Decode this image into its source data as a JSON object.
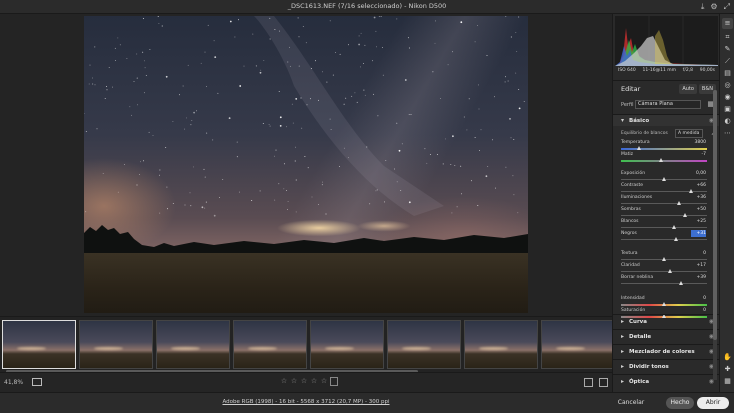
{
  "window": {
    "title": "_DSC1613.NEF (7/16 seleccionado)  -  Nikon D500"
  },
  "titlebar_icons": [
    "save-icon",
    "gear-icon",
    "expand-icon"
  ],
  "panel": {
    "exif": {
      "iso": "ISO 640",
      "lens": "11-16@11 mm",
      "aperture": "f/2,8",
      "shutter": "90,00s"
    },
    "edit": {
      "title": "Editar",
      "auto_label": "Auto",
      "bw_label": "B&N"
    },
    "profile": {
      "label": "Perfil",
      "value": "Cámara Plana"
    },
    "basic": {
      "title": "Básico",
      "wb_label": "Equilibrio de blancos",
      "wb_value": "A medida",
      "sliders": [
        {
          "label": "Temperatura",
          "value": "3800",
          "pos": 0.22,
          "track": "temp"
        },
        {
          "label": "Matiz",
          "value": "-7",
          "pos": 0.47,
          "track": "tint"
        },
        {
          "label": "Exposición",
          "value": "0,00",
          "pos": 0.5,
          "track": ""
        },
        {
          "label": "Contraste",
          "value": "+66",
          "pos": 0.82,
          "track": ""
        },
        {
          "label": "Iluminaciones",
          "value": "+36",
          "pos": 0.68,
          "track": ""
        },
        {
          "label": "Sombras",
          "value": "+50",
          "pos": 0.75,
          "track": ""
        },
        {
          "label": "Blancos",
          "value": "+25",
          "pos": 0.62,
          "track": ""
        },
        {
          "label": "Negros",
          "value": "+31",
          "pos": 0.65,
          "track": "",
          "active": true
        },
        {
          "label": "Textura",
          "value": "0",
          "pos": 0.5,
          "track": ""
        },
        {
          "label": "Claridad",
          "value": "+17",
          "pos": 0.58,
          "track": ""
        },
        {
          "label": "Borrar neblina",
          "value": "+39",
          "pos": 0.7,
          "track": ""
        },
        {
          "label": "Intensidad",
          "value": "0",
          "pos": 0.5,
          "track": "sat"
        },
        {
          "label": "Saturación",
          "value": "0",
          "pos": 0.5,
          "track": "sat"
        }
      ]
    },
    "sections": [
      {
        "label": "Curva"
      },
      {
        "label": "Detalle"
      },
      {
        "label": "Mezclador de colores"
      },
      {
        "label": "Dividir tonos"
      },
      {
        "label": "Óptica"
      }
    ]
  },
  "bottombar": {
    "zoom": "41,8%"
  },
  "statusbar": {
    "workflow": "Adobe RGB (1998) - 16 bit - 5568 x 3712 (20,7 MP) - 300 ppi",
    "cancel": "Cancelar",
    "done": "Hecho",
    "open": "Abrir"
  },
  "tools": [
    "edit-icon",
    "crop-icon",
    "healing-icon",
    "brush-icon",
    "graduated-filter-icon",
    "radial-filter-icon",
    "redeye-icon",
    "snapshot-icon",
    "presets-icon",
    "more-icon",
    "hand-icon",
    "sampler-icon",
    "grid-icon"
  ]
}
